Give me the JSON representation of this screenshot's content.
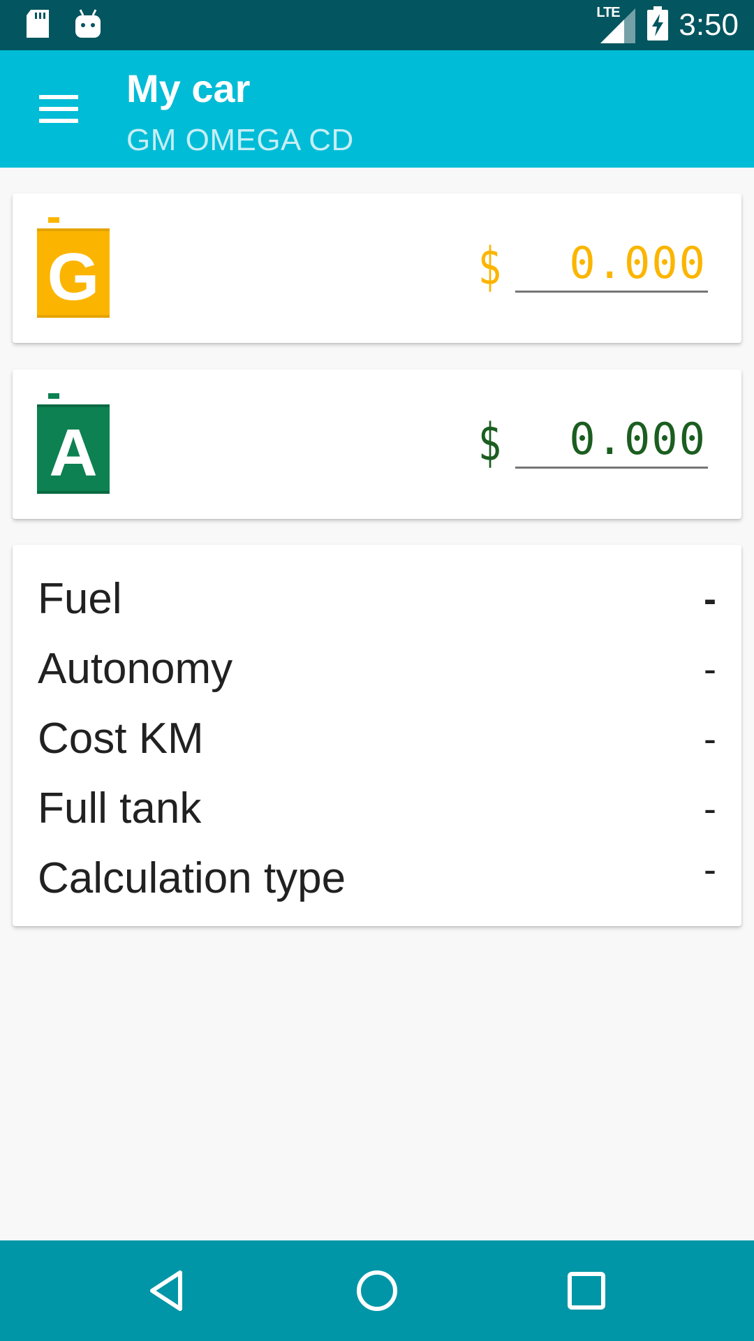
{
  "status_bar": {
    "time": "3:50",
    "network": "LTE",
    "icons": [
      "sd-card-icon",
      "android-icon",
      "signal-icon",
      "battery-charging-icon"
    ]
  },
  "app_bar": {
    "title": "My car",
    "subtitle": "GM OMEGA CD",
    "menu_icon": "hamburger-menu-icon"
  },
  "fuels": [
    {
      "letter": "G",
      "icon": "gasoline-can-icon",
      "color": "#fbb500",
      "currency": "$",
      "price": "0.000"
    },
    {
      "letter": "A",
      "icon": "alcohol-can-icon",
      "color": "#0d8151",
      "price_color": "#1b5e20",
      "currency": "$",
      "price": "0.000"
    }
  ],
  "info": {
    "rows": [
      {
        "label": "Fuel",
        "value": "-"
      },
      {
        "label": "Autonomy",
        "value": "-"
      },
      {
        "label": "Cost KM",
        "value": "-"
      },
      {
        "label": "Full tank",
        "value": "-"
      },
      {
        "label": "Calculation type",
        "value": "-"
      }
    ]
  },
  "nav_bar": {
    "buttons": [
      "back-icon",
      "home-icon",
      "recents-icon"
    ]
  },
  "colors": {
    "status_bar": "#03555f",
    "app_bar": "#00bcd6",
    "nav_bar": "#0096a7",
    "background": "#f8f8f8"
  }
}
